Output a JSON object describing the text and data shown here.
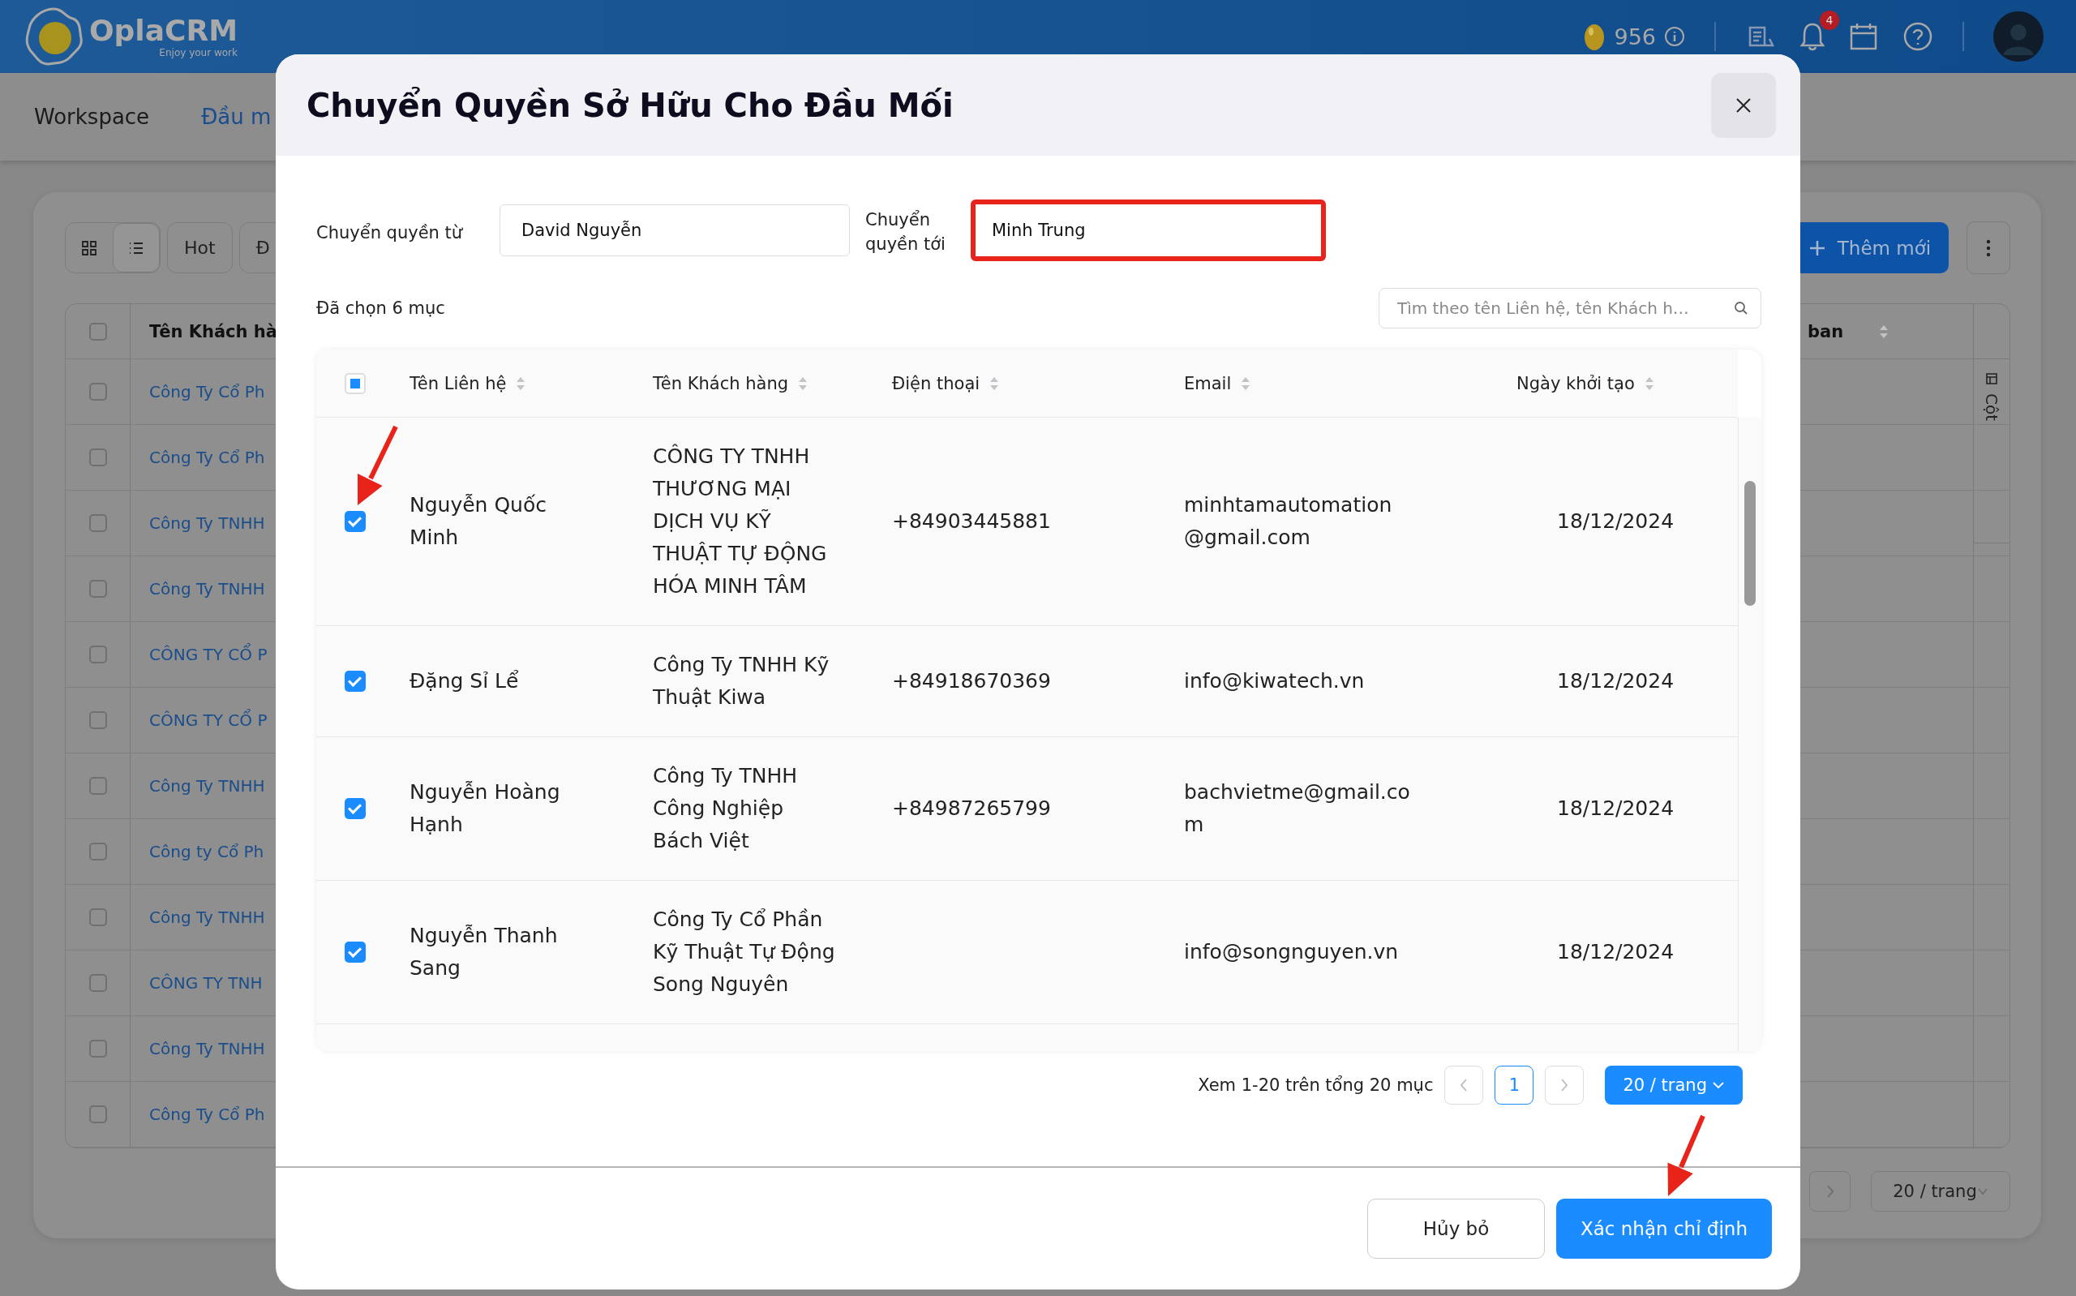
{
  "app_header": {
    "logo_name": "OplaCRM",
    "logo_tagline": "Enjoy your work",
    "coins": "956",
    "notification_count": "4"
  },
  "nav_tabs": [
    {
      "label": "Workspace",
      "selected": false
    },
    {
      "label": "Đầu m",
      "selected": true
    }
  ],
  "toolbar": {
    "views": [
      {
        "kind": "grid",
        "selected": false
      },
      {
        "kind": "list",
        "selected": true
      }
    ],
    "filters": [
      "Hot",
      "Đ"
    ],
    "add_button": "Thêm mới"
  },
  "list_table": {
    "select_all_checked": false,
    "columns": [
      "Tên Khách hà",
      "ban"
    ],
    "column_panel": "Cột",
    "rows": [
      {
        "customer": "Công Ty Cổ Ph",
        "checked": false
      },
      {
        "customer": "Công Ty Cổ Ph",
        "checked": false
      },
      {
        "customer": "Công Ty TNHH",
        "checked": false
      },
      {
        "customer": "Công Ty TNHH",
        "checked": false
      },
      {
        "customer": "CÔNG TY CỔ P",
        "checked": false
      },
      {
        "customer": "CÔNG TY CỔ P",
        "checked": false
      },
      {
        "customer": "Công Ty TNHH",
        "checked": false
      },
      {
        "customer": "Công ty Cổ Ph",
        "checked": false
      },
      {
        "customer": "Công Ty TNHH",
        "checked": false
      },
      {
        "customer": "CÔNG TY TNH",
        "checked": false
      },
      {
        "customer": "Công Ty TNHH",
        "checked": false
      },
      {
        "customer": "Công Ty Cổ Ph",
        "checked": false
      }
    ]
  },
  "list_pagination": {
    "page_size": "20 / trang"
  },
  "dialog": {
    "title": "Chuyển Quyền Sở Hữu Cho Đầu Mối",
    "transfer_from": {
      "label": "Chuyển quyền từ",
      "value": "David Nguyễn"
    },
    "transfer_to": {
      "label": "Chuyển quyền tới",
      "value": "Minh Trung",
      "highlighted": true
    },
    "selection_summary": "Đã chọn 6 mục",
    "search": {
      "placeholder": "Tìm theo tên Liên hệ, tên Khách h…"
    },
    "table": {
      "select_all_indeterminate": true,
      "columns": [
        "Tên Liên hệ",
        "Tên Khách hàng",
        "Điện thoại",
        "Email",
        "Ngày khởi tạo"
      ],
      "rows": [
        {
          "contact": "Nguyễn Quốc Minh",
          "customer": "CÔNG TY TNHH THƯƠNG MẠI DỊCH VỤ KỸ THUẬT TỰ ĐỘNG HÓA MINH TÂM",
          "phone": "+84903445881",
          "email": "minhtamautomation@gmail.com",
          "created": "18/12/2024",
          "checked": true
        },
        {
          "contact": "Đặng Sỉ Lể",
          "customer": "Công Ty TNHH Kỹ Thuật Kiwa",
          "phone": "+84918670369",
          "email": "info@kiwatech.vn",
          "created": "18/12/2024",
          "checked": true
        },
        {
          "contact": "Nguyễn Hoàng Hạnh",
          "customer": "Công Ty TNHH Công Nghiệp Bách Việt",
          "phone": "+84987265799",
          "email": "bachvietme@gmail.com",
          "created": "18/12/2024",
          "checked": true
        },
        {
          "contact": "Nguyễn Thanh Sang",
          "customer": "Công Ty Cổ Phần Kỹ Thuật Tự Động Song Nguyên",
          "email": "info@songnguyen.vn",
          "created": "18/12/2024",
          "checked": true
        }
      ]
    },
    "pagination": {
      "summary": "Xem 1-20 trên tổng 20 mục",
      "pages": [
        {
          "label": "1",
          "selected": true
        }
      ],
      "page_size": "20 / trang"
    },
    "buttons": [
      {
        "label": "Hủy bỏ",
        "kind": "secondary"
      },
      {
        "label": "Xác nhận chỉ định",
        "kind": "primary"
      }
    ]
  }
}
